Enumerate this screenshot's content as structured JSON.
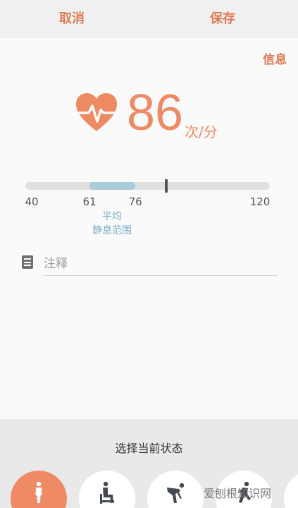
{
  "header": {
    "cancel_label": "取消",
    "save_label": "保存"
  },
  "info_label": "信息",
  "measurement": {
    "bpm": "86",
    "unit": "次/分",
    "accent_color": "#ee8b65"
  },
  "range": {
    "min": 40,
    "max": 120,
    "avg_low": 61,
    "avg_high": 76,
    "current": 86,
    "labels": {
      "min": "40",
      "avg_low": "61",
      "avg_high": "76",
      "max": "120"
    },
    "avg_caption": "平均",
    "avg_caption_2": "静息范围"
  },
  "note": {
    "placeholder": "注释",
    "value": ""
  },
  "status": {
    "title": "选择当前状态",
    "states": [
      {
        "icon": "standing-person-icon",
        "selected": true
      },
      {
        "icon": "sitting-person-icon",
        "selected": false
      },
      {
        "icon": "bending-person-icon",
        "selected": false
      },
      {
        "icon": "running-person-icon",
        "selected": false
      },
      {
        "icon": "more-state-icon",
        "selected": false
      }
    ]
  },
  "watermark": "爱刨根知识网"
}
